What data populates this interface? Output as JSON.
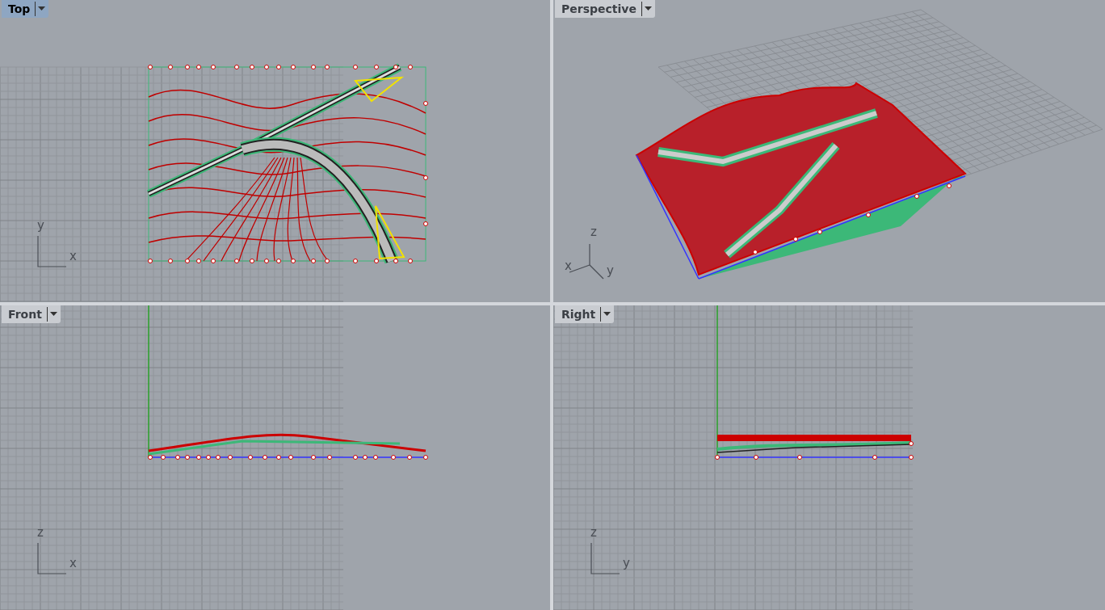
{
  "viewports": [
    {
      "kind": "top",
      "title": "Top",
      "selected": true,
      "axes": [
        "y",
        "x"
      ]
    },
    {
      "kind": "perspective",
      "title": "Perspective",
      "selected": false,
      "axes": [
        "z",
        "x",
        "y"
      ]
    },
    {
      "kind": "front",
      "title": "Front",
      "selected": false,
      "axes": [
        "z",
        "x"
      ]
    },
    {
      "kind": "right",
      "title": "Right",
      "selected": false,
      "axes": [
        "z",
        "y"
      ]
    }
  ]
}
